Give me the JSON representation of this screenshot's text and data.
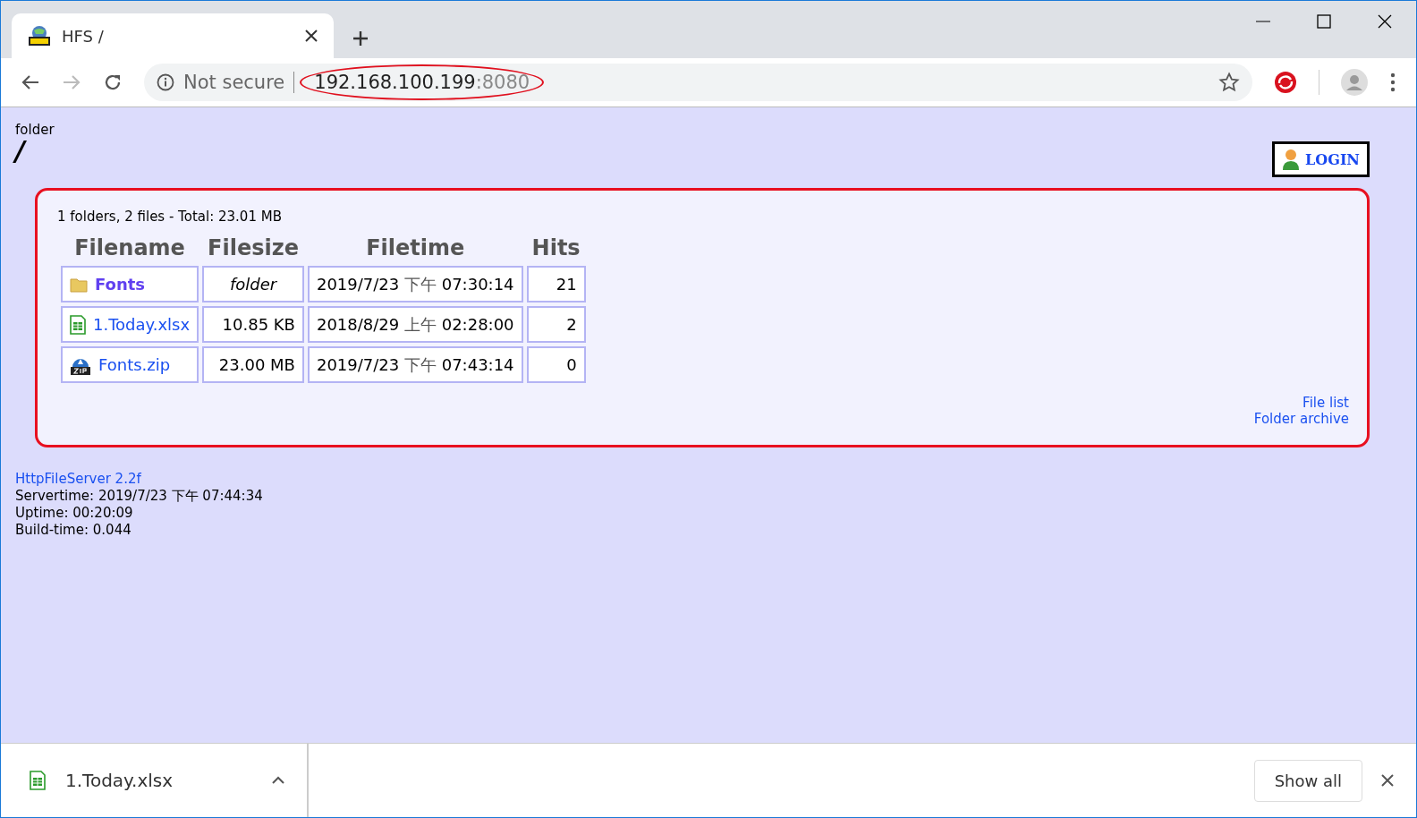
{
  "browser": {
    "tab": {
      "title": "HFS /",
      "selected": true
    },
    "address": {
      "security": "Not secure",
      "host": "192.168.100.199",
      "port": ":8080"
    }
  },
  "page": {
    "folder_label": "folder",
    "path": "/",
    "login": "LOGIN",
    "summary": "1 folders, 2 files - Total: 23.01 MB",
    "columns": [
      "Filename",
      "Filesize",
      "Filetime",
      "Hits"
    ],
    "rows": [
      {
        "kind": "folder",
        "name": "Fonts",
        "size": "folder",
        "date": "2019/7/23",
        "ampm": "下午",
        "time": "07:30:14",
        "hits": "21"
      },
      {
        "kind": "spreadsheet",
        "name": "1.Today.xlsx",
        "size": "10.85 KB",
        "date": "2018/8/29",
        "ampm": "上午",
        "time": "02:28:00",
        "hits": "2"
      },
      {
        "kind": "zip",
        "name": "Fonts.zip",
        "size": "23.00 MB",
        "date": "2019/7/23",
        "ampm": "下午",
        "time": "07:43:14",
        "hits": "0"
      }
    ],
    "links": [
      "File list",
      "Folder archive"
    ],
    "footer": {
      "server": "HttpFileServer 2.2f",
      "lines": [
        "Servertime: 2019/7/23 下午 07:44:34",
        "Uptime: 00:20:09",
        "Build-time: 0.044"
      ]
    }
  },
  "downloads": {
    "file": "1.Today.xlsx",
    "show_all": "Show all"
  }
}
